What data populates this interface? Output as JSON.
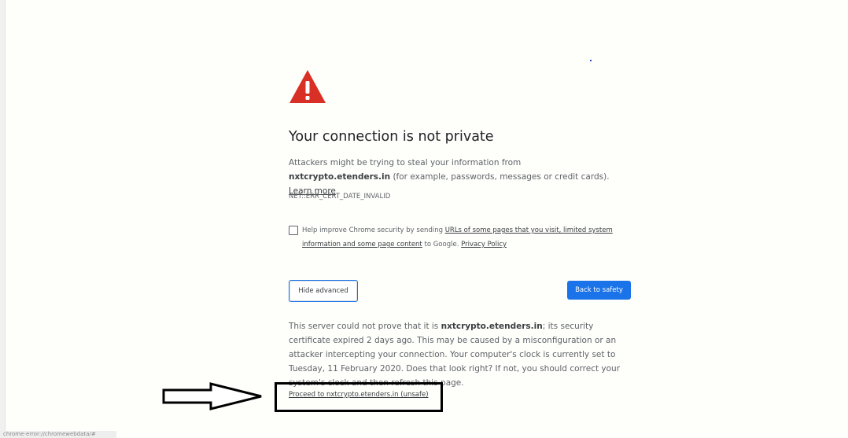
{
  "interstitial": {
    "icon": "warning-triangle-icon",
    "title": "Your connection is not private",
    "intro": {
      "part1": "Attackers might be trying to steal your information from ",
      "domain": "nxtcrypto.etenders.in",
      "part2": " (for example, passwords, messages or credit cards). ",
      "learn_more": "Learn more"
    },
    "error_code": "NET::ERR_CERT_DATE_INVALID",
    "help_checkbox": {
      "checked": false,
      "part1": "Help improve Chrome security by sending ",
      "link1": "URLs of some pages that you visit, limited system information and some page content",
      "part2": " to Google. ",
      "privacy_link": "Privacy Policy"
    },
    "hide_advanced_label": "Hide advanced",
    "back_to_safety_label": "Back to safety",
    "details": {
      "part1": "This server could not prove that it is ",
      "domain": "nxtcrypto.etenders.in",
      "part2": "; its security certificate expired 2 days ago. This may be caused by a misconfiguration or an attacker intercepting your connection. Your computer's clock is currently set to Tuesday, 11 February 2020. Does that look right? If not, you should correct your system's clock and then refresh this page."
    },
    "proceed_link": "Proceed to nxtcrypto.etenders.in (unsafe)"
  },
  "annotation": {
    "arrow_icon": "right-arrow-icon",
    "box_color": "#000000"
  },
  "status_bar": {
    "url": "chrome-error://chromewebdata/#"
  },
  "colors": {
    "accent": "#1a73e8",
    "warning": "#d93025",
    "text": "#3c4043",
    "secondary_text": "#5f6368"
  }
}
